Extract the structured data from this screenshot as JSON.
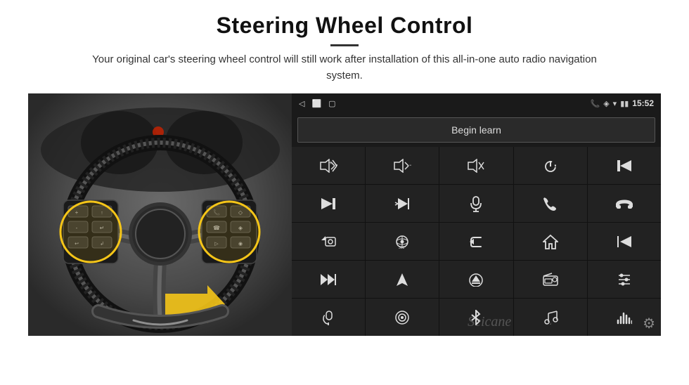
{
  "page": {
    "title": "Steering Wheel Control",
    "divider": true,
    "subtitle": "Your original car's steering wheel control will still work after installation of this all-in-one auto radio navigation system.",
    "status_bar": {
      "time": "15:52",
      "icons_left": [
        "back-arrow",
        "home-circle",
        "square"
      ],
      "icons_right": [
        "phone",
        "location",
        "wifi",
        "battery"
      ]
    },
    "begin_learn_label": "Begin learn",
    "control_buttons": [
      {
        "icon": "vol-up",
        "unicode": "🔊+"
      },
      {
        "icon": "vol-down",
        "unicode": "🔉-"
      },
      {
        "icon": "mute",
        "unicode": "🔇"
      },
      {
        "icon": "power",
        "unicode": "⏻"
      },
      {
        "icon": "prev-track",
        "unicode": "⏮"
      },
      {
        "icon": "skip-forward",
        "unicode": "⏭"
      },
      {
        "icon": "skip-back-sound",
        "unicode": "⏭"
      },
      {
        "icon": "mic",
        "unicode": "🎤"
      },
      {
        "icon": "phone-call",
        "unicode": "📞"
      },
      {
        "icon": "hang-up",
        "unicode": "📵"
      },
      {
        "icon": "speaker",
        "unicode": "📢"
      },
      {
        "icon": "360",
        "unicode": "⟳"
      },
      {
        "icon": "back",
        "unicode": "↩"
      },
      {
        "icon": "home",
        "unicode": "⌂"
      },
      {
        "icon": "rewind",
        "unicode": "⏮"
      },
      {
        "icon": "fast-forward",
        "unicode": "⏭"
      },
      {
        "icon": "navigate",
        "unicode": "▶"
      },
      {
        "icon": "eject",
        "unicode": "⏏"
      },
      {
        "icon": "radio",
        "unicode": "📻"
      },
      {
        "icon": "settings-eq",
        "unicode": "⚙"
      },
      {
        "icon": "mic2",
        "unicode": "🎤"
      },
      {
        "icon": "settings-round",
        "unicode": "⊙"
      },
      {
        "icon": "bluetooth",
        "unicode": "⚡"
      },
      {
        "icon": "music",
        "unicode": "♫"
      },
      {
        "icon": "equalizer",
        "unicode": "≋"
      }
    ],
    "seicane_watermark": "Seicane",
    "gear_icon": "⚙"
  }
}
